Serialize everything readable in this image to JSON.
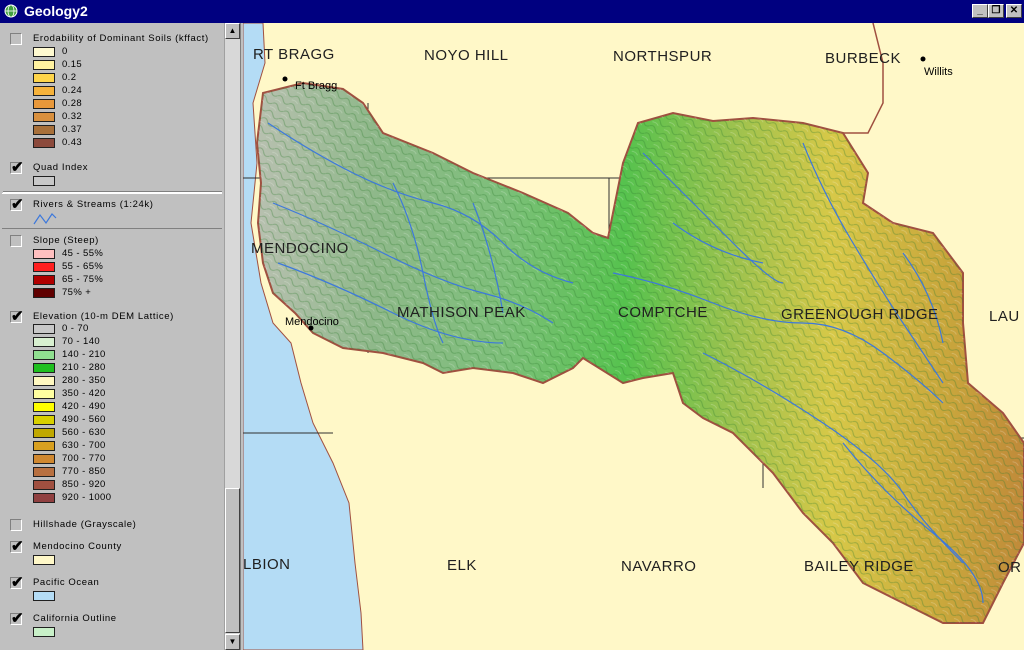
{
  "window": {
    "title": "Geology2"
  },
  "toc": {
    "layers": [
      {
        "name": "Erodability of Dominant Soils (kffact)",
        "checked": false,
        "legend": [
          {
            "label": "0",
            "color": "#fffad0"
          },
          {
            "label": "0.15",
            "color": "#fff2a0"
          },
          {
            "label": "0.2",
            "color": "#ffd54a"
          },
          {
            "label": "0.24",
            "color": "#f6b23a"
          },
          {
            "label": "0.28",
            "color": "#e8983a"
          },
          {
            "label": "0.32",
            "color": "#d9903e"
          },
          {
            "label": "0.37",
            "color": "#a8703a"
          },
          {
            "label": "0.43",
            "color": "#8c4a3c"
          }
        ]
      },
      {
        "name": "Quad Index",
        "checked": true,
        "legend": [
          {
            "label": "",
            "color": "#c8c8c8"
          }
        ]
      },
      {
        "name": "Rivers & Streams (1:24k)",
        "checked": true,
        "selected": true,
        "legend": []
      },
      {
        "name": "Slope (Steep)",
        "checked": false,
        "legend": [
          {
            "label": "45 - 55%",
            "color": "#ffc0c0"
          },
          {
            "label": "55 - 65%",
            "color": "#ff2020"
          },
          {
            "label": "65 - 75%",
            "color": "#b00000"
          },
          {
            "label": "75% +",
            "color": "#600000"
          }
        ]
      },
      {
        "name": "Elevation (10-m DEM Lattice)",
        "checked": true,
        "legend": [
          {
            "label": "0 - 70",
            "color": "#c8c8c8"
          },
          {
            "label": "70 - 140",
            "color": "#d8f0d0"
          },
          {
            "label": "140 - 210",
            "color": "#90e090"
          },
          {
            "label": "210 - 280",
            "color": "#20c020"
          },
          {
            "label": "280 - 350",
            "color": "#fff8c0"
          },
          {
            "label": "350 - 420",
            "color": "#ffffa0"
          },
          {
            "label": "420 - 490",
            "color": "#ffff00"
          },
          {
            "label": "490 - 560",
            "color": "#d8d000"
          },
          {
            "label": "560 - 630",
            "color": "#c0a800"
          },
          {
            "label": "630 - 700",
            "color": "#d8a020"
          },
          {
            "label": "700 - 770",
            "color": "#d08830"
          },
          {
            "label": "770 - 850",
            "color": "#b87040"
          },
          {
            "label": "850 - 920",
            "color": "#a05040"
          },
          {
            "label": "920 - 1000",
            "color": "#904040"
          }
        ]
      },
      {
        "name": "Hillshade (Grayscale)",
        "checked": false,
        "legend": []
      },
      {
        "name": "Mendocino County",
        "checked": true,
        "legend": [
          {
            "label": "",
            "color": "#fff8c8"
          }
        ]
      },
      {
        "name": "Pacific Ocean",
        "checked": true,
        "legend": [
          {
            "label": "",
            "color": "#b4dcf5"
          }
        ]
      },
      {
        "name": "California Outline",
        "checked": true,
        "legend": [
          {
            "label": "",
            "color": "#c8f0c8"
          }
        ]
      }
    ]
  },
  "map": {
    "quads": [
      "RT BRAGG",
      "NOYO HILL",
      "NORTHSPUR",
      "BURBECK",
      "MENDOCINO",
      "MATHISON PEAK",
      "COMPTCHE",
      "GREENOUGH RIDGE",
      "LAU",
      "LBION",
      "ELK",
      "NAVARRO",
      "BAILEY RIDGE",
      "OR"
    ],
    "towns": [
      "Ft Bragg",
      "Willits",
      "Mendocino"
    ]
  },
  "colors": {
    "titlebar": "#000080",
    "ocean": "#b4dcf5",
    "county": "#fff8c8",
    "watershed_border": "#a05040",
    "stream": "#3c78dc"
  }
}
